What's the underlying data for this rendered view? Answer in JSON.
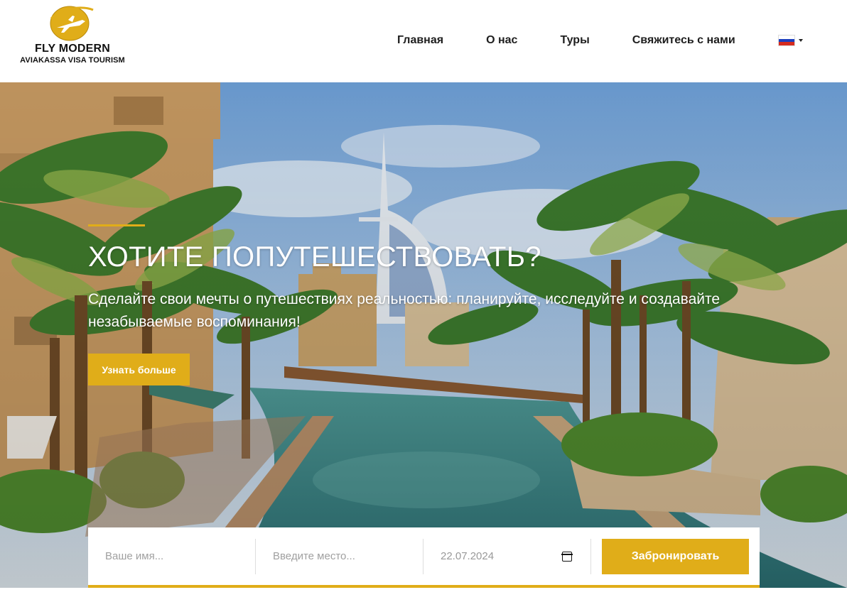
{
  "brand": {
    "title": "FLY MODERN",
    "subtitle": "AVIAKASSA VISA TOURISM",
    "logo_icon": "airplane-globe-icon",
    "accent_color": "#e0ad19"
  },
  "nav": {
    "items": [
      {
        "label": "Главная"
      },
      {
        "label": "О нас"
      },
      {
        "label": "Туры"
      },
      {
        "label": "Свяжитесь с нами"
      }
    ],
    "language": {
      "icon": "russian-flag-icon",
      "dropdown_icon": "caret-down-icon"
    }
  },
  "hero": {
    "title": "ХОТИТЕ ПОПУТЕШЕСТВОВАТЬ?",
    "subtitle": "Сделайте свои мечты о путешествиях реальностью: планируйте, исследуйте и создавайте незабываемые воспоминания!",
    "cta_label": "Узнать больше"
  },
  "booking": {
    "name_placeholder": "Ваше имя...",
    "place_placeholder": "Введите место...",
    "date_value": "22.07.2024",
    "date_icon": "calendar-icon",
    "submit_label": "Забронировать"
  }
}
